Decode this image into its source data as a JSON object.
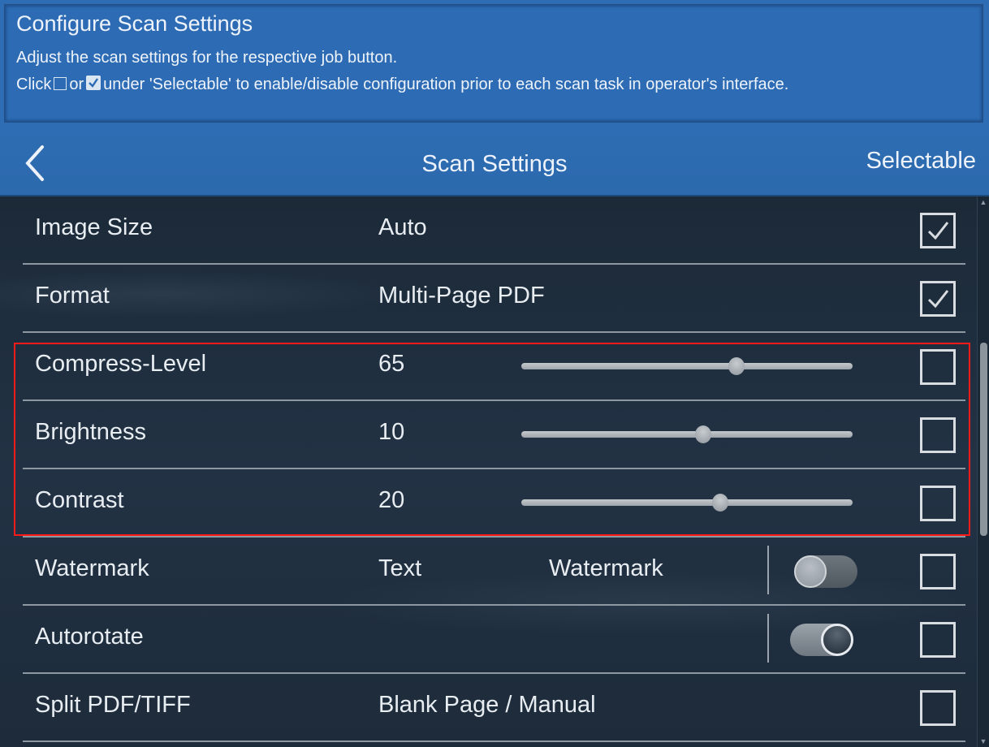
{
  "info": {
    "title": "Configure Scan Settings",
    "line1": "Adjust the scan settings for the respective job button.",
    "line2_prefix": "Click",
    "line2_or": "or",
    "line2_suffix": "under 'Selectable' to enable/disable configuration prior to each scan task in operator's interface."
  },
  "nav": {
    "back_icon": "chevron-left-icon",
    "title": "Scan Settings",
    "right_label": "Selectable"
  },
  "settings": [
    {
      "label": "Image Size",
      "value": "Auto",
      "selectable": true
    },
    {
      "label": "Format",
      "value": "Multi-Page PDF",
      "selectable": true
    },
    {
      "label": "Compress-Level",
      "value": "65",
      "slider_fraction": 0.65,
      "selectable": false
    },
    {
      "label": "Brightness",
      "value": "10",
      "slider_fraction": 0.55,
      "selectable": false
    },
    {
      "label": "Contrast",
      "value": "20",
      "slider_fraction": 0.6,
      "selectable": false
    },
    {
      "label": "Watermark",
      "value": "Text",
      "value2": "Watermark",
      "toggle_on": false,
      "selectable": false
    },
    {
      "label": "Autorotate",
      "toggle_on": true,
      "selectable": false
    },
    {
      "label": "Split PDF/TIFF",
      "value": "Blank Page / Manual",
      "selectable": false
    }
  ],
  "colors": {
    "header_blue": "#2e6db3",
    "highlight_red": "#ff1a1a"
  }
}
